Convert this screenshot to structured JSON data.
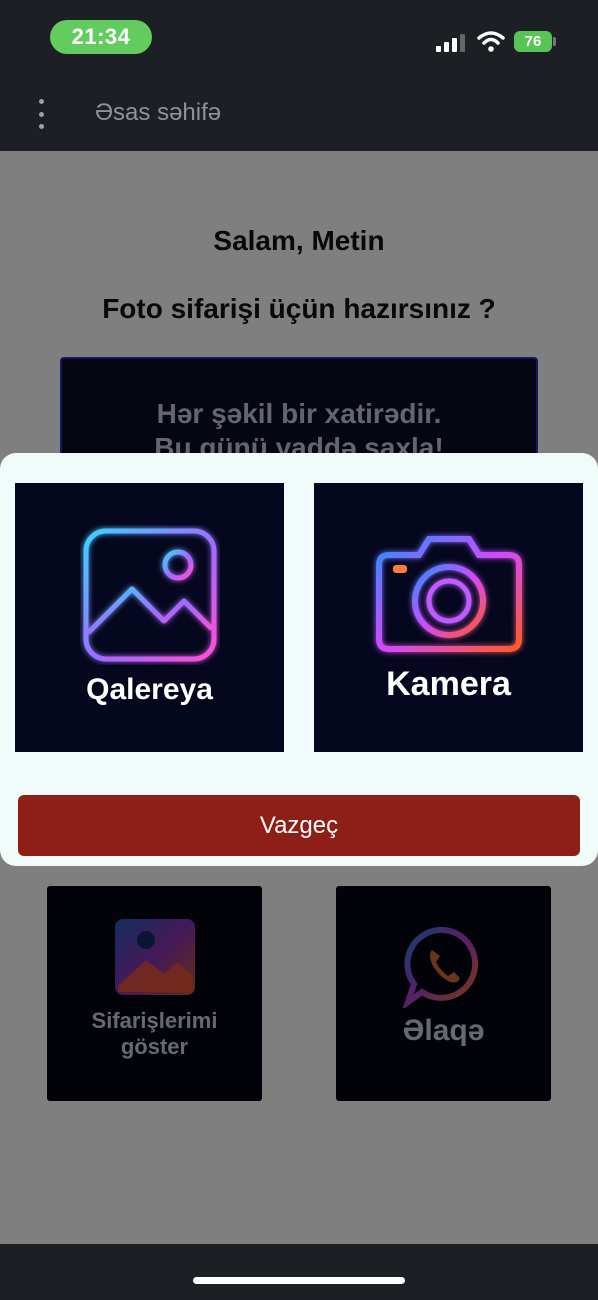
{
  "status_bar": {
    "time": "21:34",
    "battery": "76"
  },
  "app_bar": {
    "title": "Əsas səhifə"
  },
  "main": {
    "greeting": "Salam,  Metin",
    "question": "Foto sifarişi üçün hazırsınız ?",
    "banner_line1": "Hər şəkil bir xatirədir.",
    "banner_line2": "Bu günü yaddə saxla!",
    "orders_tile": {
      "line1": "Sifarişlerimi",
      "line2": "göster"
    },
    "contact_tile": {
      "label": "Əlaqə"
    }
  },
  "sheet": {
    "gallery_label": "Qalereya",
    "camera_label": "Kamera",
    "cancel_label": "Vazgeç"
  },
  "colors": {
    "accent_red": "#8e1f17",
    "status_green": "#63cc5e",
    "sheet_bg": "#f1fbf9",
    "tile_bg": "#05071f"
  },
  "icons": [
    "menu-icon",
    "signal-icon",
    "wifi-icon",
    "battery-icon",
    "gallery-icon",
    "camera-icon",
    "orders-icon",
    "whatsapp-icon"
  ]
}
